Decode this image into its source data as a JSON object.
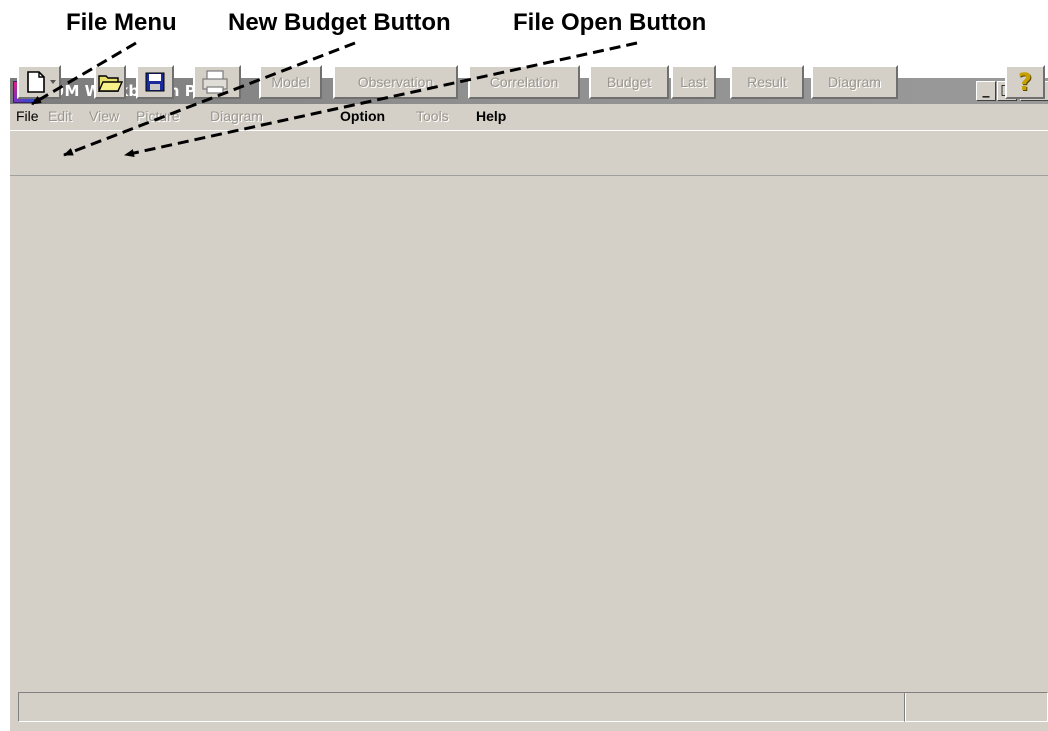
{
  "annotations": {
    "file_menu": "File Menu",
    "new_budget_button": "New Budget Button",
    "file_open_button": "File Open Button"
  },
  "window": {
    "title": "GUM Workbench Pro",
    "controls": {
      "minimize": "_",
      "maximize": "□",
      "close": "X"
    }
  },
  "menubar": {
    "items": [
      {
        "label": "File",
        "enabled": true
      },
      {
        "label": "Edit",
        "enabled": false
      },
      {
        "label": "View",
        "enabled": false
      },
      {
        "label": "Picture",
        "enabled": false
      },
      {
        "label": "Diagram",
        "enabled": false
      },
      {
        "label": "Option",
        "enabled": true
      },
      {
        "label": "Tools",
        "enabled": false
      },
      {
        "label": "Help",
        "enabled": true
      }
    ]
  },
  "toolbar": {
    "icons": [
      "new-document-icon",
      "dropdown-arrow-icon",
      "open-folder-icon",
      "save-disk-icon",
      "printer-icon",
      "help-icon"
    ],
    "help_label": "?",
    "tabs": [
      {
        "label": "Model",
        "enabled": false
      },
      {
        "label": "Observation",
        "enabled": false
      },
      {
        "label": "Correlation",
        "enabled": false
      },
      {
        "label": "Budget",
        "enabled": false
      },
      {
        "label": "Last",
        "enabled": false
      },
      {
        "label": "Result",
        "enabled": false
      },
      {
        "label": "Diagram",
        "enabled": false
      }
    ]
  },
  "statusbar": {
    "panels": [
      "",
      ""
    ]
  },
  "colors": {
    "face": "#d4d0c8",
    "disabled_text": "#9a968e",
    "title_bar": "#8e8e8e",
    "help_icon": "#c8a000"
  }
}
